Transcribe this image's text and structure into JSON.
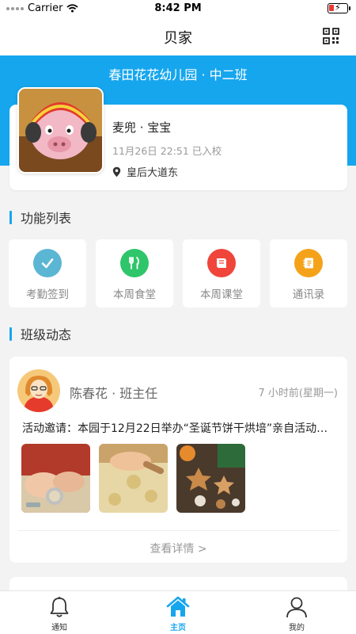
{
  "status_bar": {
    "carrier": "Carrier",
    "time": "8:42 PM"
  },
  "nav": {
    "title": "贝家"
  },
  "class_banner": {
    "title": "春田花花幼儿园 · 中二班"
  },
  "child": {
    "name": "麦兜 · 宝宝",
    "checkin": "11月26日 22:51 已入校",
    "location": "皇后大道东"
  },
  "features": {
    "section_title": "功能列表",
    "items": [
      {
        "label": "考勤签到",
        "icon": "checkmark-icon",
        "color": "#5bb6d4"
      },
      {
        "label": "本周食堂",
        "icon": "fork-knife-icon",
        "color": "#2fc56a"
      },
      {
        "label": "本周课堂",
        "icon": "book-icon",
        "color": "#f0453a"
      },
      {
        "label": "通讯录",
        "icon": "contacts-book-icon",
        "color": "#f5a21b"
      }
    ]
  },
  "feed": {
    "section_title": "班级动态",
    "post": {
      "author": "陈春花 · 班主任",
      "time": "7 小时前(星期一)",
      "text": "活动邀请：本园于12月22日举办“圣诞节饼干烘培”亲自活动…",
      "more": "查看详情 >"
    }
  },
  "tabs": [
    {
      "label": "通知",
      "icon": "bell-icon"
    },
    {
      "label": "主页",
      "icon": "home-icon"
    },
    {
      "label": "我的",
      "icon": "person-icon"
    }
  ],
  "colors": {
    "accent": "#16a6ee",
    "background": "#f3f3f3"
  }
}
